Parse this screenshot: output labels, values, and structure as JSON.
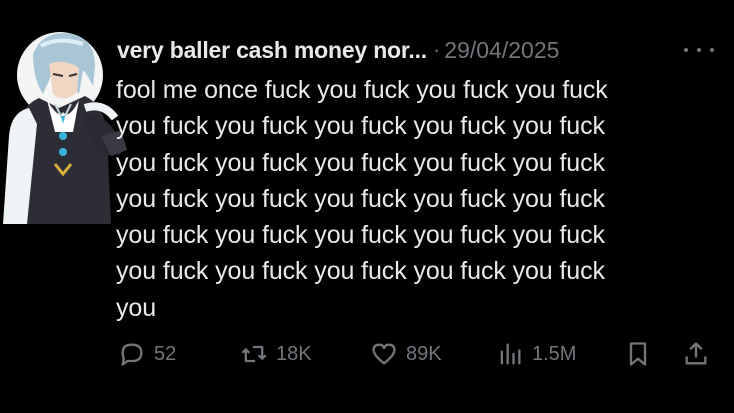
{
  "tweet": {
    "display_name": "very baller cash money nor...",
    "separator": "·",
    "date": "29/04/2025",
    "text": "fool me once fuck you fuck you fuck you fuck\nyou fuck you fuck you fuck you fuck you fuck\nyou fuck you fuck you fuck you fuck you fuck\nyou fuck you fuck you fuck you fuck you fuck\nyou fuck you fuck you fuck you fuck you fuck\nyou fuck you fuck you fuck you fuck you fuck\nyou"
  },
  "actions": {
    "replies": "52",
    "reposts": "18K",
    "likes": "89K",
    "views": "1.5M"
  },
  "icons": {
    "more": "more-horizontal-icon",
    "reply": "reply-bubble-icon",
    "repost": "repost-arrows-icon",
    "like": "heart-icon",
    "views": "bar-chart-icon",
    "bookmark": "bookmark-icon",
    "share": "share-upload-icon"
  },
  "colors": {
    "background": "#000000",
    "text": "#e7e9ea",
    "muted": "#71767b"
  }
}
